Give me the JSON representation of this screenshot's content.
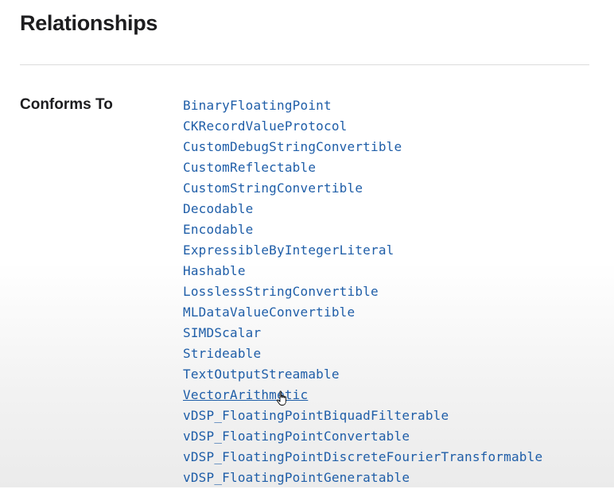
{
  "page": {
    "title": "Relationships"
  },
  "relationships": {
    "label": "Conforms To",
    "protocols": [
      "BinaryFloatingPoint",
      "CKRecordValueProtocol",
      "CustomDebugStringConvertible",
      "CustomReflectable",
      "CustomStringConvertible",
      "Decodable",
      "Encodable",
      "ExpressibleByIntegerLiteral",
      "Hashable",
      "LosslessStringConvertible",
      "MLDataValueConvertible",
      "SIMDScalar",
      "Strideable",
      "TextOutputStreamable",
      "VectorArithmetic",
      "vDSP_FloatingPointBiquadFilterable",
      "vDSP_FloatingPointConvertable",
      "vDSP_FloatingPointDiscreteFourierTransformable",
      "vDSP_FloatingPointGeneratable"
    ],
    "hovered_protocol": "VectorArithmetic"
  },
  "colors": {
    "link": "#1f5ea8",
    "text": "#1d1d1f"
  },
  "cursor": {
    "icon": "hand-pointer-icon"
  }
}
